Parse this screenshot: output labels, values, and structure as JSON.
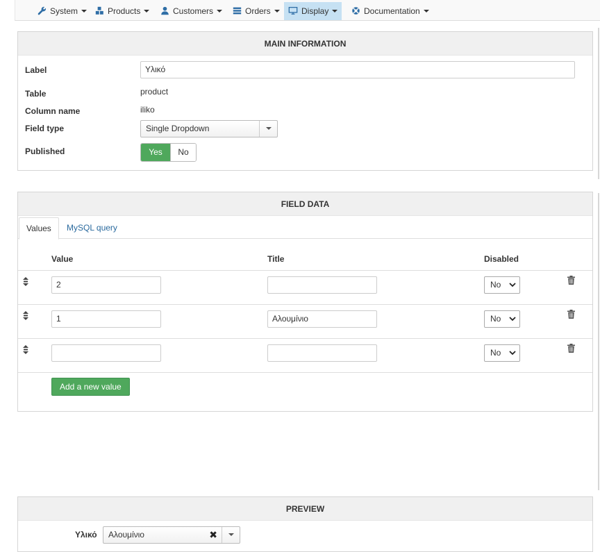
{
  "nav": {
    "items": [
      {
        "label": "System",
        "icon": "wrench-icon"
      },
      {
        "label": "Products",
        "icon": "cubes-icon"
      },
      {
        "label": "Customers",
        "icon": "user-icon"
      },
      {
        "label": "Orders",
        "icon": "list-icon"
      },
      {
        "label": "Display",
        "icon": "monitor-icon"
      },
      {
        "label": "Documentation",
        "icon": "lifebuoy-icon"
      }
    ],
    "active": "Display"
  },
  "main": {
    "title": "MAIN INFORMATION",
    "label_label": "Label",
    "label_value": "Υλικό",
    "table_label": "Table",
    "table_value": "product",
    "column_label": "Column name",
    "column_value": "iliko",
    "fieldtype_label": "Field type",
    "fieldtype_value": "Single Dropdown",
    "published_label": "Published",
    "published_yes": "Yes",
    "published_no": "No"
  },
  "field_data": {
    "title": "FIELD DATA",
    "tabs": [
      "Values",
      "MySQL query"
    ],
    "columns": {
      "value": "Value",
      "title": "Title",
      "disabled": "Disabled"
    },
    "rows": [
      {
        "value": "2",
        "title": "",
        "disabled": "No"
      },
      {
        "value": "1",
        "title": "Αλουμίνιο",
        "disabled": "No"
      },
      {
        "value": "",
        "title": "",
        "disabled": "No"
      }
    ],
    "add_button": "Add a new value"
  },
  "preview": {
    "title": "PREVIEW",
    "field_label": "Υλικό",
    "selected_value": "Αλουμίνιο"
  },
  "colors": {
    "active_nav": "#c6e1f3",
    "green": "#4fa85c",
    "link": "#2a6a9e"
  }
}
